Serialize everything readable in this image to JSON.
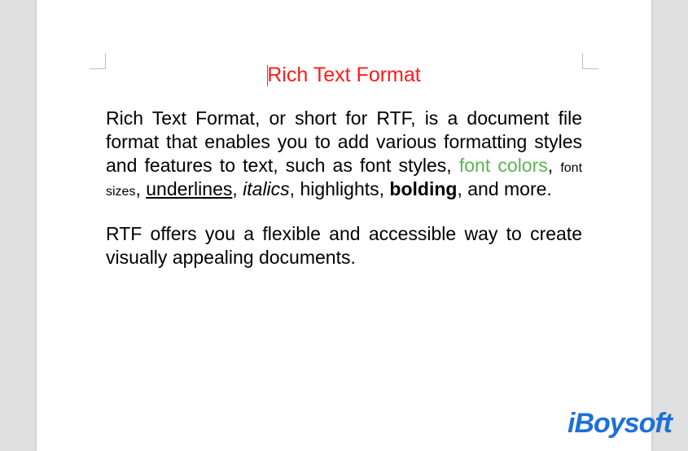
{
  "title": "Rich Text Format",
  "para1": {
    "t1": "Rich Text Format, or short for RTF, is a document file format that enables you to add various formatting styles and features to text, such as font styles, ",
    "font_colors": "font colors",
    "t2": ", ",
    "font_sizes": "font sizes",
    "t3": ", ",
    "underlines": "underlines",
    "t4": ", ",
    "italics": "italics",
    "t5": ", highlights, ",
    "bolding": "bolding",
    "t6": ", and more."
  },
  "para2": "RTF offers you a flexible and accessible way to create visually appealing documents.",
  "logo": "iBoysoft"
}
